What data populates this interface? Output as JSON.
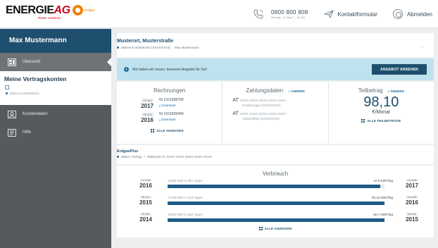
{
  "header": {
    "logo_main": "ENERGIE",
    "logo_ag": "AG",
    "logo_sub": "Power Solutions",
    "logo_partner": "erdgas",
    "phone_number": "0800 800 808",
    "phone_hours": "Montag - Freitag 7 - 18 Uhr",
    "contact_label": "Kontaktformular",
    "logout_label": "Abmelden"
  },
  "sidebar": {
    "user_name": "Max Mustermann",
    "overview_label": "Übersicht",
    "contracts_title": "Meine Vertragskonten",
    "account_status": "aktives Kundenkonto",
    "customer_data_label": "Kundendaten",
    "help_label": "Hilfe"
  },
  "address": {
    "title": "Musterort, Musterstraße",
    "account_line": "aktives Kundenkonto (XXXXXXXX)",
    "holder": "Max Mustermann"
  },
  "offer": {
    "text": "Wir haben ein neues, besseres Angebot für Sie!",
    "button": "ANGEBOT ANSEHEN"
  },
  "bills": {
    "title": "Rechnungen",
    "items": [
      {
        "day": "27.JUL",
        "year": "2017",
        "number": "Nr 2101998799",
        "download": "Download"
      },
      {
        "day": "28.JUL",
        "year": "2016",
        "number": "Nr 2101839499",
        "download": "Download"
      }
    ],
    "show_all": "ALLE ANZEIGEN"
  },
  "payment": {
    "title": "Zahlungsdaten",
    "edit": "ÄNDERN",
    "lines": [
      {
        "country": "AT",
        "iban": "XXXX XXXX XXXX XXXX XXXX",
        "label": "Forderungen (XXXXXXXX)"
      },
      {
        "country": "AT",
        "iban": "XXXX XXXX XXXX XXXX XXXX",
        "label": "Gutschriften (XXXXXXXX)"
      }
    ]
  },
  "installment": {
    "title": "Teilbetrag",
    "edit": "ÄNDERN",
    "amount": "98,10",
    "unit": "€/Monat",
    "show_all": "ALLE TEILBETRÄGE"
  },
  "contract": {
    "title": "ErdgasPlus",
    "status": "aktiver Vertrag",
    "meter": "Zählpunkt AT XXXX XXXX XXXX XXXX XXXX"
  },
  "usage": {
    "title": "Verbrauch",
    "rows": [
      {
        "from_day": "17.JUN",
        "from_year": "2016",
        "to_day": "12.JUN",
        "to_year": "2017",
        "days": "12182 kWh in 361 Tagen",
        "rate": "47,6 kWh/Tag",
        "fill": 0.98
      },
      {
        "from_day": "08.JUL",
        "from_year": "2015",
        "to_day": "16.JUN",
        "to_year": "2016",
        "days": "17349 kWh in 344 Tagen",
        "rate": "50,43 kWh/Tag",
        "fill": 1.0
      },
      {
        "from_day": "12.JUL",
        "from_year": "2014",
        "to_day": "08.JUL",
        "to_year": "2015",
        "days": "18353 kWh in 362 Tagen",
        "rate": "50,7 kWh/Tag",
        "fill": 1.0
      }
    ],
    "show_all": "ALLE ANZEIGEN"
  }
}
